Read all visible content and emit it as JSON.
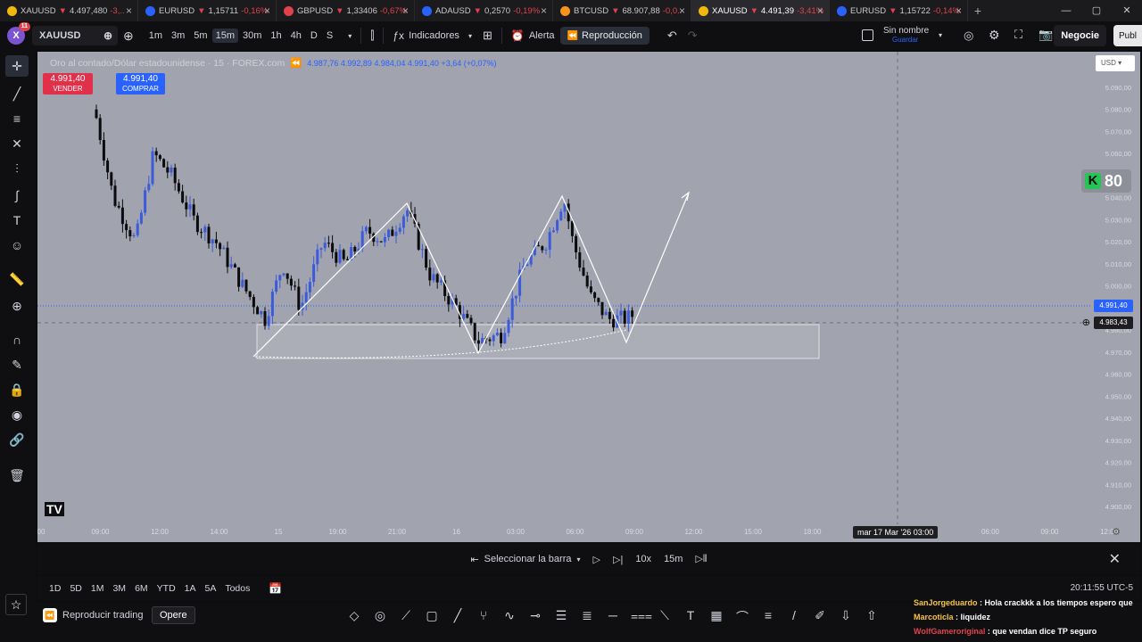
{
  "browser": {
    "tabs": [
      {
        "symbol": "XAUUSD",
        "price": "4.497,480",
        "change": "-3,..",
        "favicon_color": "#f0b90b",
        "active": false
      },
      {
        "symbol": "EURUSD",
        "price": "1,15711",
        "change": "-0,16%",
        "favicon_color": "#2962ff",
        "active": false
      },
      {
        "symbol": "GBPUSD",
        "price": "1,33406",
        "change": "-0,67%",
        "favicon_color": "#e0424b",
        "active": false
      },
      {
        "symbol": "ADAUSD",
        "price": "0,2570",
        "change": "-0,19%",
        "favicon_color": "#2962ff",
        "active": false
      },
      {
        "symbol": "BTCUSD",
        "price": "68.907,88",
        "change": "-0,0..",
        "favicon_color": "#f7931a",
        "active": false
      },
      {
        "symbol": "XAUUSD",
        "price": "4.491,39",
        "change": "-3,41%",
        "favicon_color": "#f0b90b",
        "active": true
      },
      {
        "symbol": "EURUSD",
        "price": "1,15722",
        "change": "-0,14%",
        "favicon_color": "#2962ff",
        "active": false
      }
    ]
  },
  "toolbar": {
    "avatar_letter": "X",
    "notif_count": "11",
    "symbol": "XAUUSD",
    "timeframes": [
      "1m",
      "3m",
      "5m",
      "15m",
      "30m",
      "1h",
      "4h",
      "D",
      "S"
    ],
    "active_timeframe": "15m",
    "indicators_label": "Indicadores",
    "alert_label": "Alerta",
    "replay_label": "Reproducción",
    "layout_name": "Sin nombre",
    "save_label": "Guardar",
    "trade_label": "Negocie",
    "publish_label": "Publ"
  },
  "chart": {
    "legend_title": "Oro al contado/Dólar estadounidense · 15 · FOREX.com",
    "ohlc": "4.987,76  4.992,89  4.984,04  4.991,40  +3,64 (+0,07%)",
    "sell_price": "4.991,40",
    "sell_label": "VENDER",
    "buy_price": "4.991,40",
    "buy_label": "COMPRAR",
    "currency": "USD",
    "indicator_value": "80",
    "price_last": "4.991,40",
    "price_cursor": "4.983,43",
    "crosshair_date": "mar 17 Mar '26   03:00",
    "logo": "TV"
  },
  "chart_data": {
    "type": "candlestick",
    "symbol": "XAUUSD",
    "timeframe": "15m",
    "yticks": [
      "5.090,00",
      "5.080,00",
      "5.070,00",
      "5.060,00",
      "5.050,00",
      "5.040,00",
      "5.030,00",
      "5.020,00",
      "5.010,00",
      "5.000,00",
      "4.990,00",
      "4.980,00",
      "4.970,00",
      "4.960,00",
      "4.950,00",
      "4.940,00",
      "4.930,00",
      "4.920,00",
      "4.910,00",
      "4.900,00"
    ],
    "xticks": [
      "00",
      "09:00",
      "12:00",
      "14:00",
      "15",
      "19:00",
      "21:00",
      "16",
      "03:00",
      "06:00",
      "09:00",
      "12:00",
      "15:00",
      "18:00",
      "21:00",
      "17",
      "06:00",
      "09:00",
      "12:00"
    ],
    "ylim": [
      4895,
      5095
    ]
  },
  "replay": {
    "select_bar_label": "Seleccionar la barra",
    "speed": "10x",
    "interval": "15m"
  },
  "bottom": {
    "ranges": [
      "1D",
      "5D",
      "1M",
      "3M",
      "6M",
      "YTD",
      "1A",
      "5A",
      "Todos"
    ],
    "clock": "20:11:55 UTC-5"
  },
  "footer": {
    "replay_trading_label": "Reproducir trading",
    "trade_button": "Opere"
  },
  "chat": [
    {
      "user": "SanJorgeduardo",
      "msg": "Hola crackkk a los tiempos espero que",
      "user_color": "#f5c542"
    },
    {
      "user": "Marcoticla",
      "msg": "liquidez",
      "user_color": "#f5c542"
    },
    {
      "user": "WolfGameroriginal",
      "msg": "que vendan dice TP seguro",
      "user_color": "#e0424b"
    }
  ]
}
